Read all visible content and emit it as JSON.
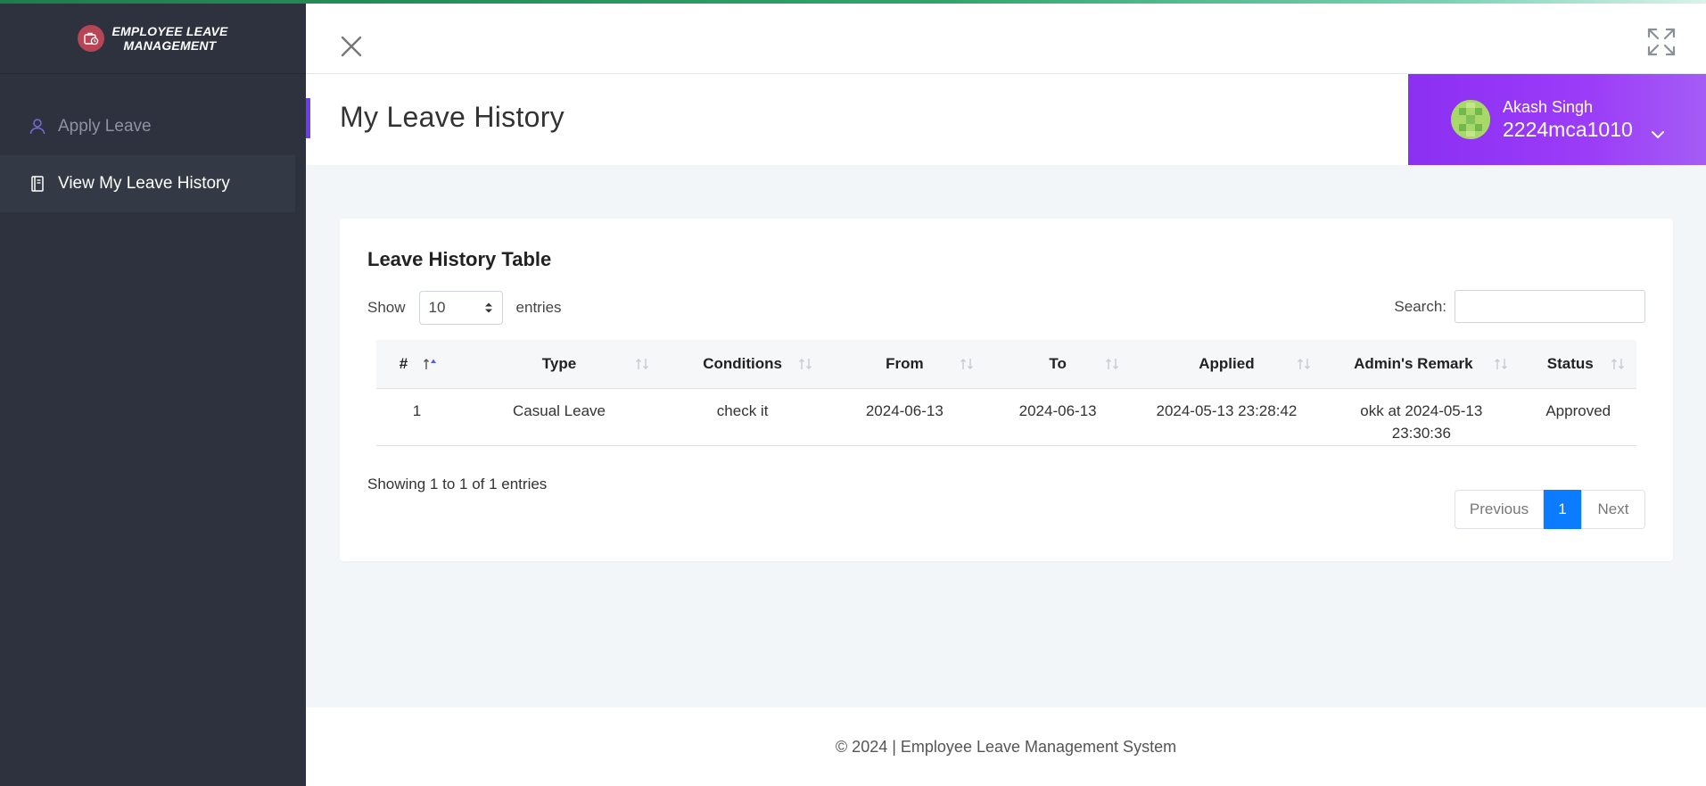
{
  "brand": {
    "line1": "Employee Leave",
    "line2": "Management"
  },
  "sidebar": {
    "items": [
      {
        "label": "Apply Leave",
        "icon": "user-icon"
      },
      {
        "label": "View My Leave History",
        "icon": "document-icon"
      }
    ]
  },
  "header": {
    "title": "My Leave History"
  },
  "user": {
    "name": "Akash Singh",
    "id": "2224mca1010"
  },
  "card": {
    "title": "Leave History Table",
    "show_label": "Show",
    "entries_value": "10",
    "entries_label": "entries",
    "search_label": "Search:",
    "search_value": ""
  },
  "table": {
    "headers": [
      "#",
      "Type",
      "Conditions",
      "From",
      "To",
      "Applied",
      "Admin's Remark",
      "Status"
    ],
    "rows": [
      {
        "num": "1",
        "type": "Casual Leave",
        "conditions": "check it",
        "from": "2024-06-13",
        "to": "2024-06-13",
        "applied": "2024-05-13 23:28:42",
        "remark_line1": "okk at 2024-05-13",
        "remark_line2": "23:30:36",
        "status": "Approved"
      }
    ]
  },
  "info": "Showing 1 to 1 of 1 entries",
  "pagination": {
    "previous": "Previous",
    "current": "1",
    "next": "Next"
  },
  "footer": "© 2024 | Employee Leave Management System",
  "colors": {
    "sidebar_bg": "#2d323e",
    "user_box": "#9b3cf8",
    "accent": "#6b3cf6",
    "page_active": "#0b7cff",
    "status_approved": "#228b22"
  }
}
